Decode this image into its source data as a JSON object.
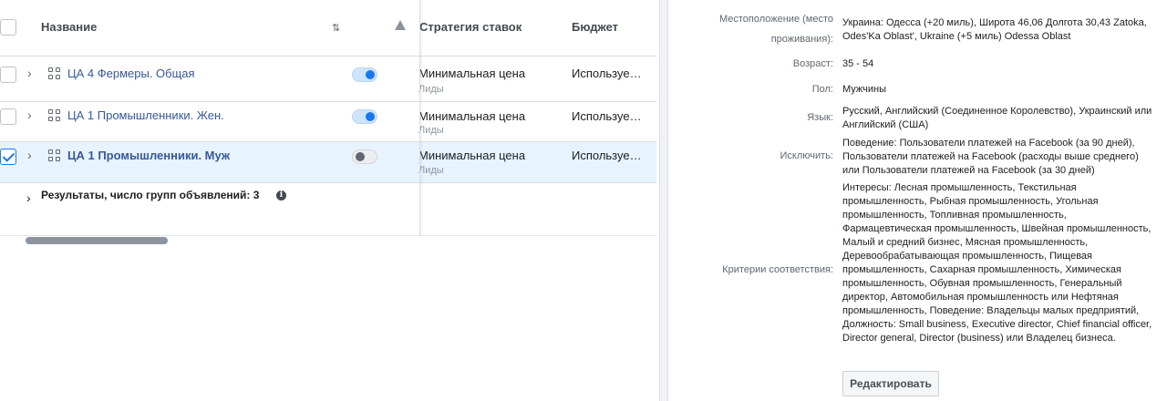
{
  "table": {
    "header": {
      "name": "Название",
      "sort_icon": "⇅",
      "bid_strategy": "Стратегия ставок",
      "budget": "Бюджет"
    },
    "rows": [
      {
        "name": "ЦА 4 Фермеры. Общая",
        "toggle": "on",
        "strategy": "Минимальная цена",
        "strategy_sub": "Лиды",
        "budget": "Используе…",
        "checked": false,
        "selected": false
      },
      {
        "name": "ЦА 1 Промышленники. Жен.",
        "toggle": "on",
        "strategy": "Минимальная цена",
        "strategy_sub": "Лиды",
        "budget": "Используе…",
        "checked": false,
        "selected": false
      },
      {
        "name": "ЦА 1 Промышленники. Муж",
        "toggle": "off",
        "strategy": "Минимальная цена",
        "strategy_sub": "Лиды",
        "budget": "Используе…",
        "checked": true,
        "selected": true
      }
    ],
    "summary": {
      "chevron": "›",
      "text": "Результаты, число групп объявлений: 3",
      "info_icon": "i"
    },
    "chevron": "›"
  },
  "details": {
    "location_label_line1": "Местоположение (место",
    "location_label_line2": "проживания):",
    "location_value": "Украина: Одесса (+20 миль), Широта 46,06 Долгота 30,43 Zatoka, Odes'Ka Oblast', Ukraine (+5 миль) Odessa Oblast",
    "age_label": "Возраст:",
    "age_value": "35 - 54",
    "gender_label": "Пол:",
    "gender_value": "Мужчины",
    "language_label": "Язык:",
    "language_value": "Русский, Английский (Соединенное Королевство), Украинский или Английский (США)",
    "exclude_label": "Исключить:",
    "exclude_value": "Поведение: Пользователи платежей на Facebook (за 90 дней), Пользователи платежей на Facebook (расходы выше среднего) или Пользователи платежей на Facebook (за 30 дней)",
    "criteria_label": "Критерии соответствия:",
    "criteria_value": "Интересы: Лесная промышленность, Текстильная промышленность, Рыбная промышленность, Угольная промышленность, Топливная промышленность, Фармацевтическая промышленность, Швейная промышленность, Малый и средний бизнес, Мясная промышленность, Деревообрабатывающая промышленность, Пищевая промышленность, Сахарная промышленность, Химическая промышленность, Обувная промышленность, Генеральный директор, Автомобильная промышленность или Нефтяная промышленность, Поведение: Владельцы малых предприятий, Должность: Small business, Executive director, Chief financial officer, Director general, Director (business) или Владелец бизнеса.",
    "edit_button": "Редактировать"
  }
}
